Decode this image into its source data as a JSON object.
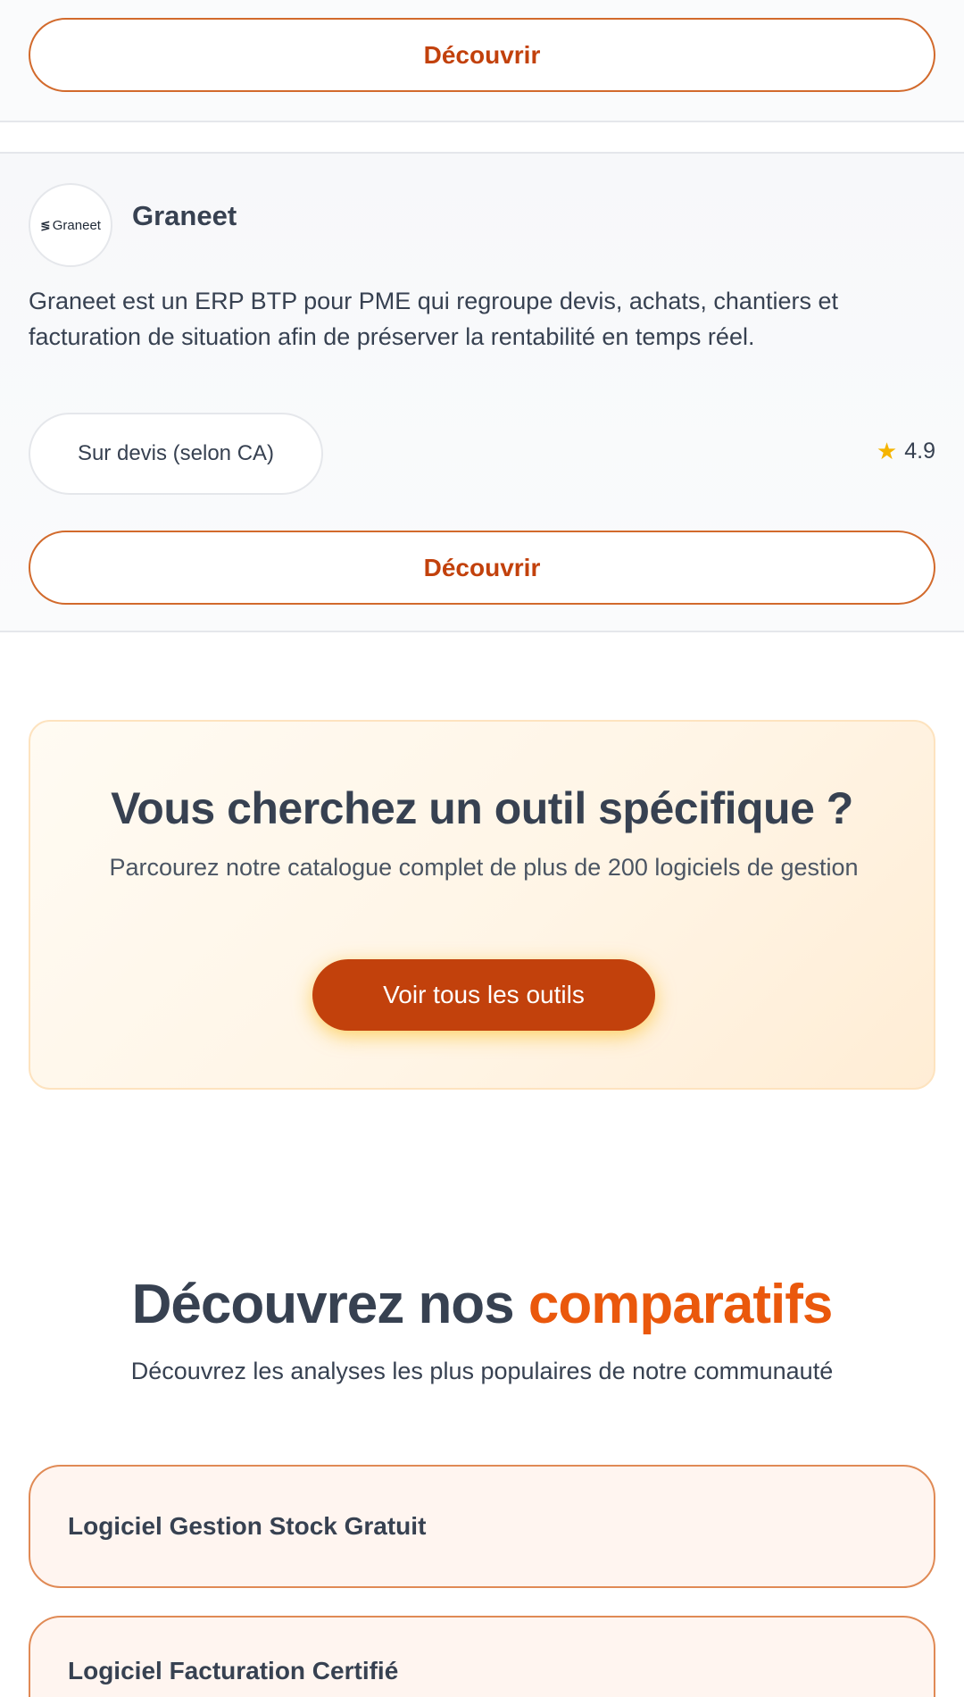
{
  "top_card": {
    "discover_label": "Découvrir"
  },
  "graneet_card": {
    "logo_text": "Graneet",
    "logo_icon": "graneet-logo-icon",
    "name": "Graneet",
    "description": "Graneet est un ERP BTP pour PME qui regroupe devis, achats, chantiers et facturation de situation afin de préserver la rentabilité en temps réel.",
    "price": "Sur devis (selon CA)",
    "rating": "4.9",
    "rating_icon": "star-icon",
    "discover_label": "Découvrir"
  },
  "cta": {
    "title": "Vous cherchez un outil spécifique ?",
    "subtitle": "Parcourez notre catalogue complet de plus de 200 logiciels de gestion",
    "button_label": "Voir tous les outils"
  },
  "comparatifs": {
    "title_prefix": "Découvrez nos",
    "title_accent": "comparatifs",
    "subtitle": "Découvrez les analyses les plus populaires de notre communauté",
    "items": [
      {
        "label": "Logiciel Gestion Stock Gratuit"
      },
      {
        "label": "Logiciel Facturation Certifié"
      }
    ]
  },
  "colors": {
    "accent": "#c2410c",
    "accent_bright": "#ea580c",
    "star": "#f5b400",
    "cta_bg": "#fff5e6"
  }
}
